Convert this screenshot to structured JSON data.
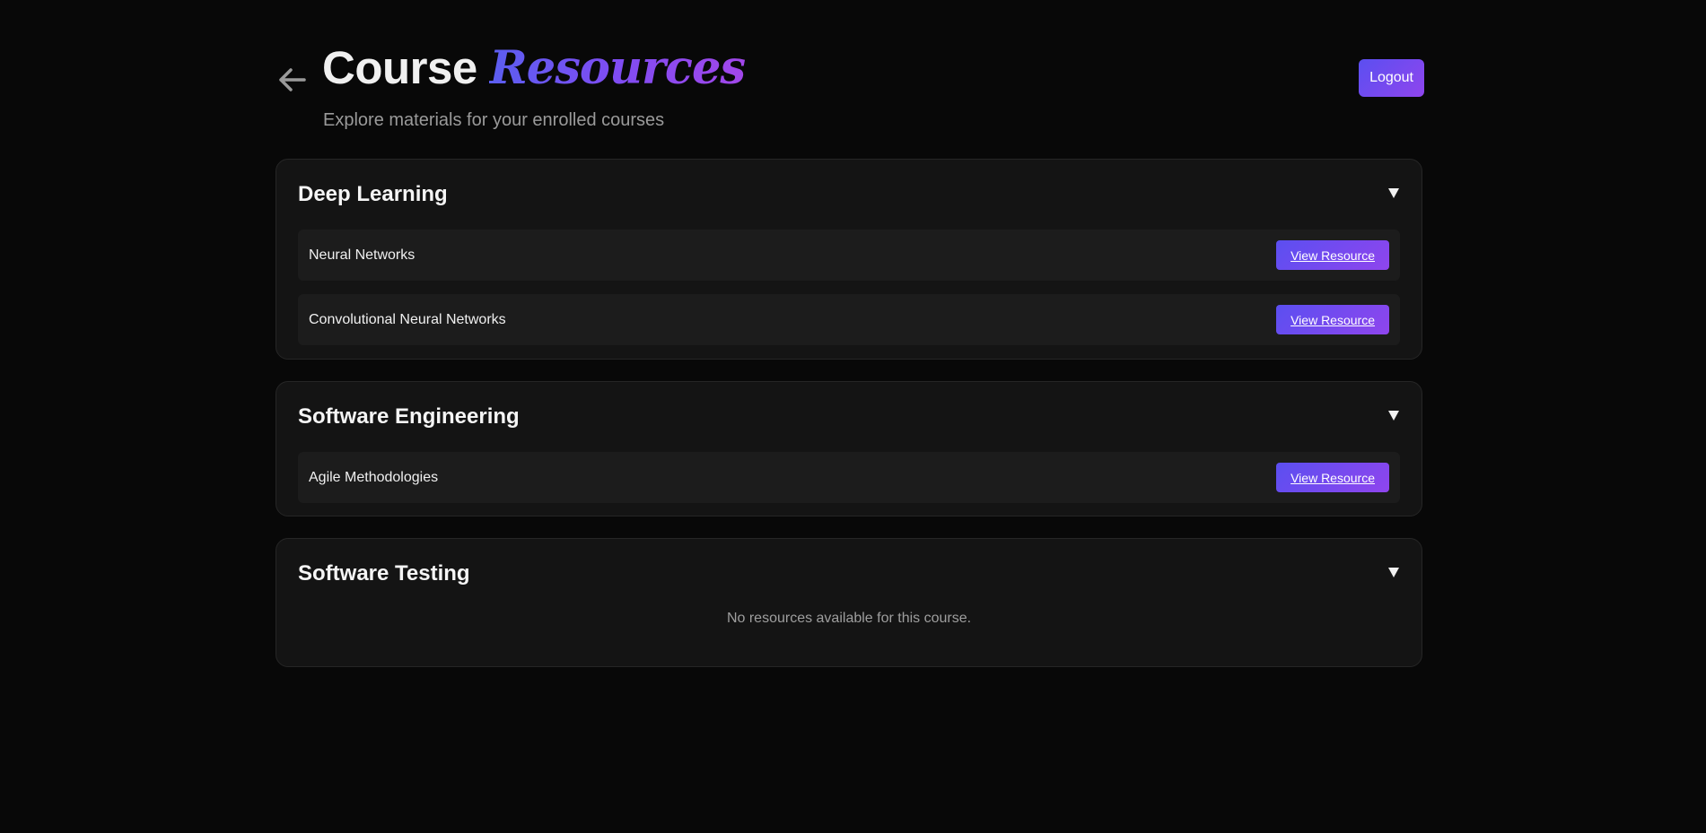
{
  "header": {
    "back_icon": "arrow-left-icon",
    "title_main": "Course",
    "title_accent": "Resources",
    "subtitle": "Explore materials for your enrolled courses",
    "logout_label": "Logout"
  },
  "colors": {
    "background": "#080808",
    "card": "#141414",
    "row": "#1c1c1c",
    "accent_start": "#5b4ff0",
    "accent_end": "#8f45ee"
  },
  "courses": [
    {
      "title": "Deep Learning",
      "toggle_icon": "caret-down-icon",
      "resources": [
        {
          "name": "Neural Networks",
          "button_label": "View Resource"
        },
        {
          "name": "Convolutional Neural Networks",
          "button_label": "View Resource"
        }
      ]
    },
    {
      "title": "Software Engineering",
      "toggle_icon": "caret-down-icon",
      "resources": [
        {
          "name": "Agile Methodologies",
          "button_label": "View Resource"
        }
      ]
    },
    {
      "title": "Software Testing",
      "toggle_icon": "caret-down-icon",
      "resources": [],
      "empty_message": "No resources available for this course."
    }
  ]
}
